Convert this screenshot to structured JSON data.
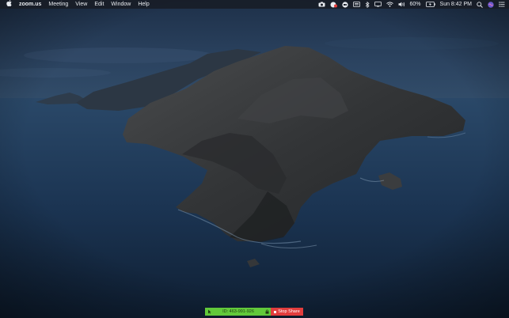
{
  "menubar": {
    "apple_icon": "apple-logo-icon",
    "app_name": "zoom.us",
    "menus": [
      "Meeting",
      "View",
      "Edit",
      "Window",
      "Help"
    ],
    "status": {
      "battery_percent": "60%",
      "clock": "Sun 8:42 PM"
    },
    "status_icons": [
      "camera-icon",
      "zoom-record-icon",
      "zoom-video-icon",
      "keyboard-icon",
      "bluetooth-icon",
      "display-icon",
      "wifi-icon",
      "volume-icon",
      "battery-icon",
      "spotlight-search-icon",
      "siri-icon",
      "notification-center-icon"
    ]
  },
  "desktop": {
    "wallpaper": "catalina-island-night",
    "colors": {
      "sky_top": "#1c2e47",
      "sea": "#1d3554",
      "rock": "#3a3c3f"
    }
  },
  "share_toolbar": {
    "meeting_id_label": "ID: 463-991-926",
    "stop_share_label": "Stop Share",
    "colors": {
      "meeting_pill": "#62c93a",
      "stop_button": "#e23d3d"
    }
  }
}
